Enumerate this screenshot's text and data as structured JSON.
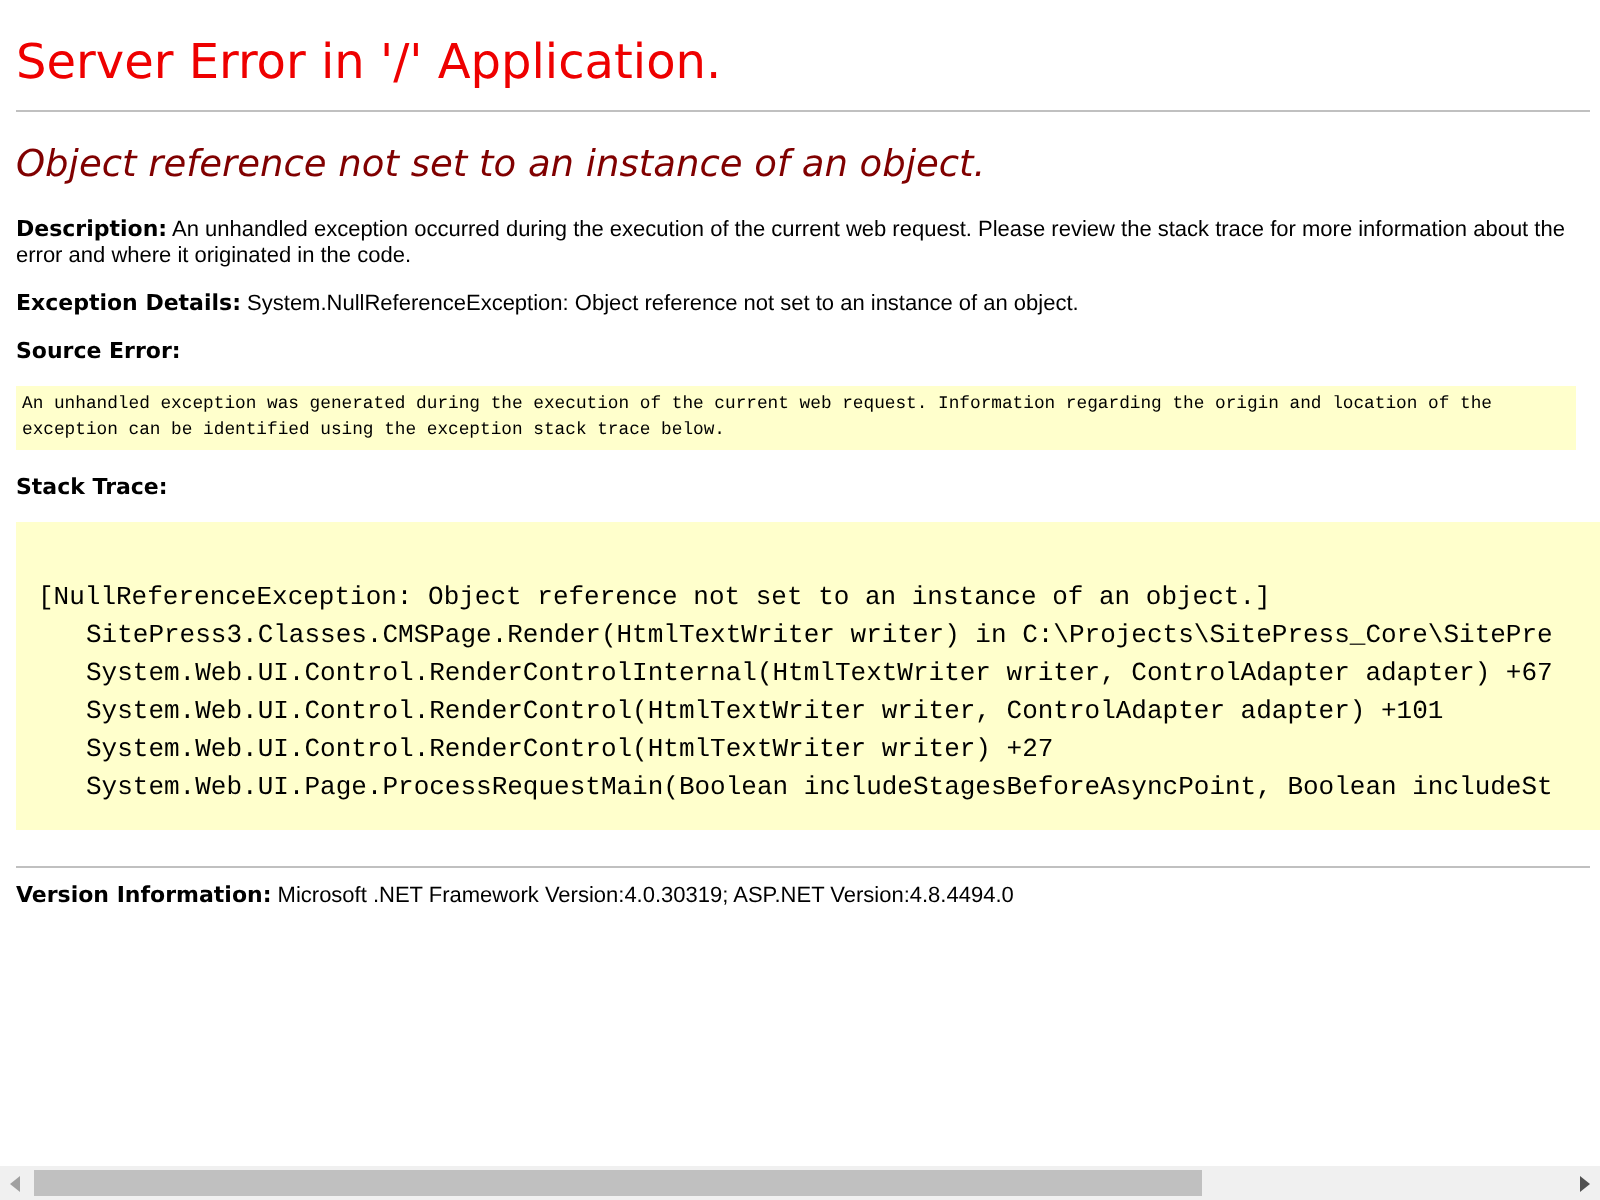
{
  "title": "Server Error in '/' Application.",
  "error_message": "Object reference not set to an instance of an object.",
  "description": {
    "label": "Description:",
    "text": "An unhandled exception occurred during the execution of the current web request. Please review the stack trace for more information about the error and where it originated in the code."
  },
  "exception_details": {
    "label": "Exception Details:",
    "text": "System.NullReferenceException: Object reference not set to an instance of an object."
  },
  "source_error": {
    "label": "Source Error:",
    "text": "An unhandled exception was generated during the execution of the current web request. Information regarding the origin and location of the exception can be identified using the exception stack trace below."
  },
  "stack_trace": {
    "label": "Stack Trace:",
    "header": "[NullReferenceException: Object reference not set to an instance of an object.]",
    "frames": [
      "SitePress3.Classes.CMSPage.Render(HtmlTextWriter writer) in C:\\Projects\\SitePress_Core\\SitePre",
      "System.Web.UI.Control.RenderControlInternal(HtmlTextWriter writer, ControlAdapter adapter) +67",
      "System.Web.UI.Control.RenderControl(HtmlTextWriter writer, ControlAdapter adapter) +101",
      "System.Web.UI.Control.RenderControl(HtmlTextWriter writer) +27",
      "System.Web.UI.Page.ProcessRequestMain(Boolean includeStagesBeforeAsyncPoint, Boolean includeSt"
    ]
  },
  "version_information": {
    "label": "Version Information:",
    "text": "Microsoft .NET Framework Version:4.0.30319; ASP.NET Version:4.8.4494.0"
  }
}
